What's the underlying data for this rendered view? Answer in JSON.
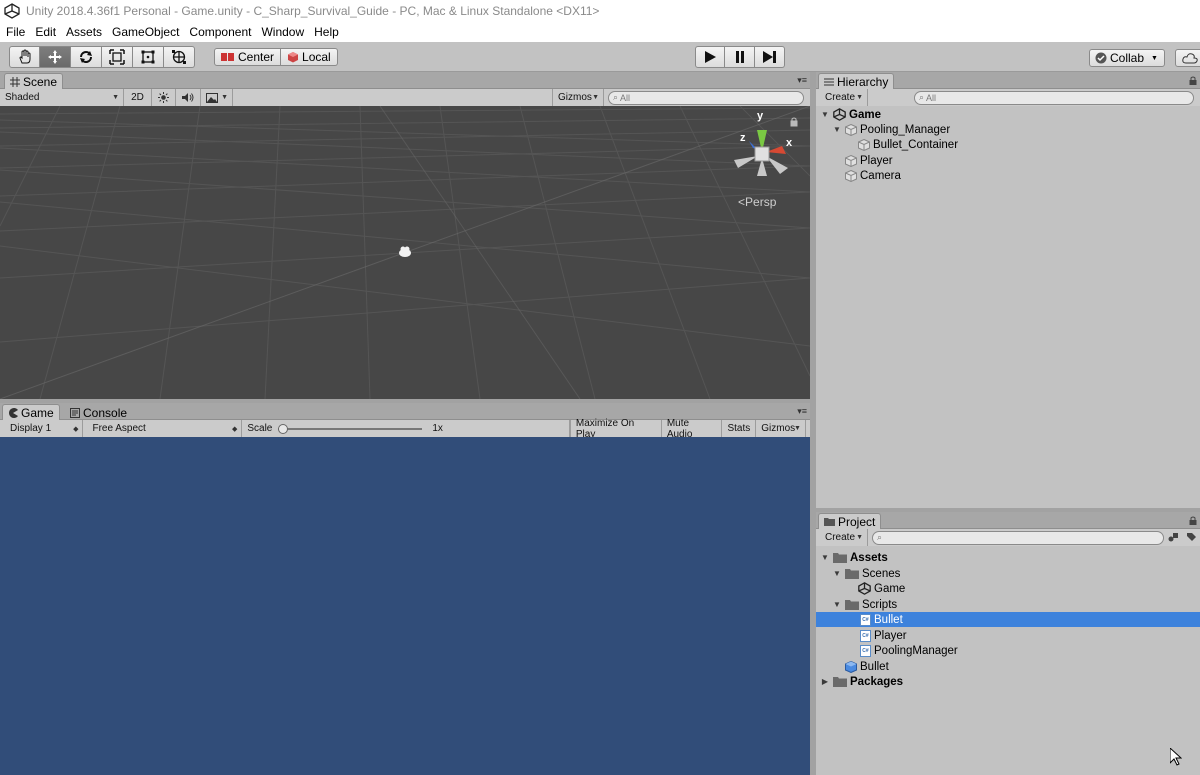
{
  "window": {
    "title": "Unity 2018.4.36f1 Personal - Game.unity - C_Sharp_Survival_Guide - PC, Mac & Linux Standalone <DX11>"
  },
  "menu": [
    "File",
    "Edit",
    "Assets",
    "GameObject",
    "Component",
    "Window",
    "Help"
  ],
  "toolbar": {
    "pivot_center": "Center",
    "pivot_local": "Local",
    "collab": "Collab"
  },
  "scene": {
    "tab": "Scene",
    "shading": "Shaded",
    "mode_2d": "2D",
    "gizmos": "Gizmos",
    "search_placeholder": "All",
    "persp": "Persp",
    "axis_x": "x",
    "axis_y": "y",
    "axis_z": "z"
  },
  "game": {
    "tab_game": "Game",
    "tab_console": "Console",
    "display": "Display 1",
    "aspect": "Free Aspect",
    "scale_label": "Scale",
    "scale_value": "1x",
    "scale_fraction": 0,
    "maximize": "Maximize On Play",
    "mute": "Mute Audio",
    "stats": "Stats",
    "gizmos": "Gizmos"
  },
  "hierarchy": {
    "tab": "Hierarchy",
    "create": "Create",
    "search_placeholder": "All",
    "scene_name": "Game",
    "items": [
      "Pooling_Manager",
      "Bullet_Container",
      "Player",
      "Camera"
    ]
  },
  "project": {
    "tab": "Project",
    "create": "Create",
    "assets": "Assets",
    "scenes": "Scenes",
    "scene_game": "Game",
    "scripts": "Scripts",
    "script_items": [
      "Bullet",
      "Player",
      "PoolingManager"
    ],
    "prefab_bullet": "Bullet",
    "packages": "Packages",
    "script_badge": "C#"
  },
  "colors": {
    "game_bg": "#314d79",
    "scene_bg": "#474747",
    "selection": "#3d82dc"
  }
}
